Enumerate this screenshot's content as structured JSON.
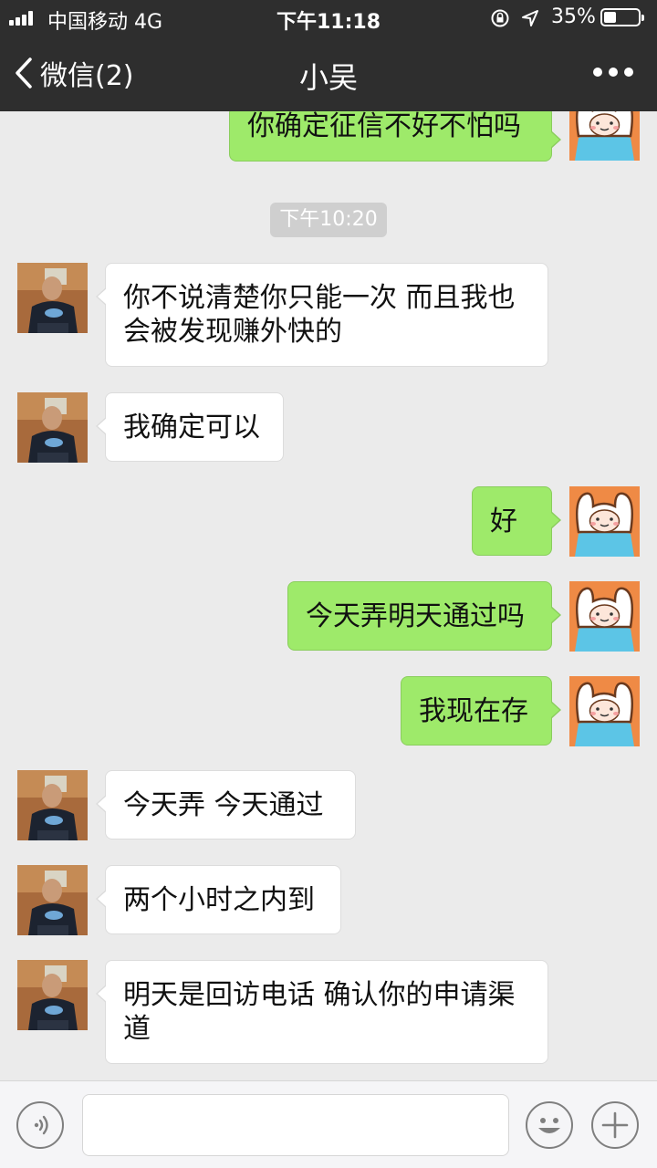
{
  "status_bar": {
    "carrier": "中国移动  4G",
    "time": "下午11:18",
    "battery": "35%"
  },
  "nav": {
    "back_label": "微信(2)",
    "title": "小吴"
  },
  "chat": {
    "timestamp": "下午10:20",
    "messages": [
      {
        "side": "right",
        "text": "你确定征信不好不怕吗"
      },
      {
        "side": "left",
        "text": "你不说清楚你只能一次 而且我也会被发现赚外快的"
      },
      {
        "side": "left",
        "text": "我确定可以"
      },
      {
        "side": "right",
        "text": "好"
      },
      {
        "side": "right",
        "text": "今天弄明天通过吗"
      },
      {
        "side": "right",
        "text": "我现在存"
      },
      {
        "side": "left",
        "text": "今天弄 今天通过"
      },
      {
        "side": "left",
        "text": "两个小时之内到"
      },
      {
        "side": "left",
        "text": "明天是回访电话 确认你的申请渠道"
      }
    ]
  },
  "input_bar": {
    "placeholder": ""
  },
  "colors": {
    "header": "#2e2e2e",
    "sent_bubble": "#9eea6a",
    "received_bubble": "#ffffff",
    "background": "#ebebeb"
  },
  "icons": {
    "back": "chevron-left-icon",
    "more": "more-dots-icon",
    "voice": "voice-icon",
    "emoji": "emoji-icon",
    "plus": "plus-icon"
  }
}
